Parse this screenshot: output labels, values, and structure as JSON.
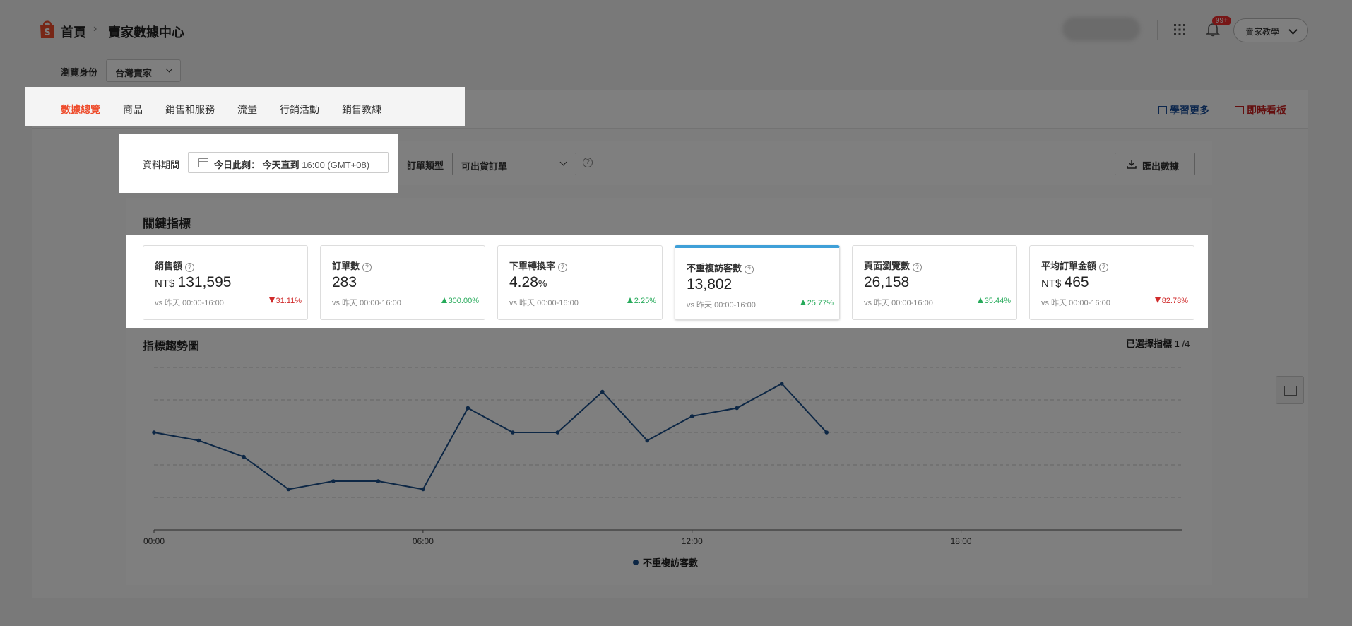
{
  "header": {
    "breadcrumb_home": "首頁",
    "breadcrumb_sep": "›",
    "breadcrumb_current": "賣家數據中心",
    "notification_badge": "99+",
    "tutorial_label": "賣家教學"
  },
  "identity": {
    "label": "瀏覽身份",
    "value": "台灣賣家"
  },
  "nav": {
    "tabs": [
      {
        "label": "數據總覽",
        "active": true
      },
      {
        "label": "商品"
      },
      {
        "label": "銷售和服務"
      },
      {
        "label": "流量"
      },
      {
        "label": "行銷活動"
      },
      {
        "label": "銷售教練"
      }
    ],
    "learn_more": "學習更多",
    "live_board": "即時看板"
  },
  "filters": {
    "period_label": "資料期間",
    "period_prefix": "今日此刻：",
    "period_bold": "今天直到",
    "period_time": "16:00 (GMT+08)",
    "order_type_label": "訂單類型",
    "order_type_value": "可出貨訂單",
    "export_label": "匯出數據"
  },
  "kpi": {
    "title": "關鍵指標",
    "metrics": [
      {
        "name": "銷售額",
        "prefix": "NT$ ",
        "value": "131,595",
        "suffix": "",
        "compare": "vs 昨天 00:00-16:00",
        "change": "31.11%",
        "direction": "down"
      },
      {
        "name": "訂單數",
        "prefix": "",
        "value": "283",
        "suffix": "",
        "compare": "vs 昨天 00:00-16:00",
        "change": "300.00%",
        "direction": "up"
      },
      {
        "name": "下單轉換率",
        "prefix": "",
        "value": "4.28",
        "suffix": "%",
        "compare": "vs 昨天 00:00-16:00",
        "change": "2.25%",
        "direction": "up"
      },
      {
        "name": "不重複訪客數",
        "prefix": "",
        "value": "13,802",
        "suffix": "",
        "compare": "vs 昨天 00:00-16:00",
        "change": "25.77%",
        "direction": "up",
        "selected": true
      },
      {
        "name": "頁面瀏覽數",
        "prefix": "",
        "value": "26,158",
        "suffix": "",
        "compare": "vs 昨天 00:00-16:00",
        "change": "35.44%",
        "direction": "up"
      },
      {
        "name": "平均訂單金額",
        "prefix": "NT$ ",
        "value": "465",
        "suffix": "",
        "compare": "vs 昨天 00:00-16:00",
        "change": "82.78%",
        "direction": "down"
      }
    ]
  },
  "trend": {
    "title": "指標趨勢圖",
    "selected_label": "已選擇指標",
    "selected_value": "1 /4"
  },
  "colors": {
    "accent": "#ee4d2d",
    "line": "#1a4f8b",
    "up": "#26aa5a",
    "down": "#d02b2b",
    "selected_bar": "#3fa0d8"
  },
  "chart_data": {
    "type": "line",
    "x": [
      0,
      1,
      2,
      3,
      4,
      5,
      6,
      7,
      8,
      9,
      10,
      11,
      12,
      13,
      14,
      15
    ],
    "x_ticks": [
      0,
      6,
      12,
      18
    ],
    "x_tick_labels": [
      "00:00",
      "06:00",
      "12:00",
      "18:00"
    ],
    "xlim": [
      0,
      23
    ],
    "ylim": [
      0,
      5
    ],
    "series": [
      {
        "name": "不重複訪客數",
        "values": [
          3,
          2.75,
          2.25,
          1.25,
          1.5,
          1.5,
          1.25,
          3.75,
          3,
          3,
          4.25,
          2.75,
          3.5,
          3.75,
          4.5,
          3
        ]
      }
    ],
    "y_tick_labels_shown": false,
    "grid": true,
    "legend": "bottom-center"
  }
}
